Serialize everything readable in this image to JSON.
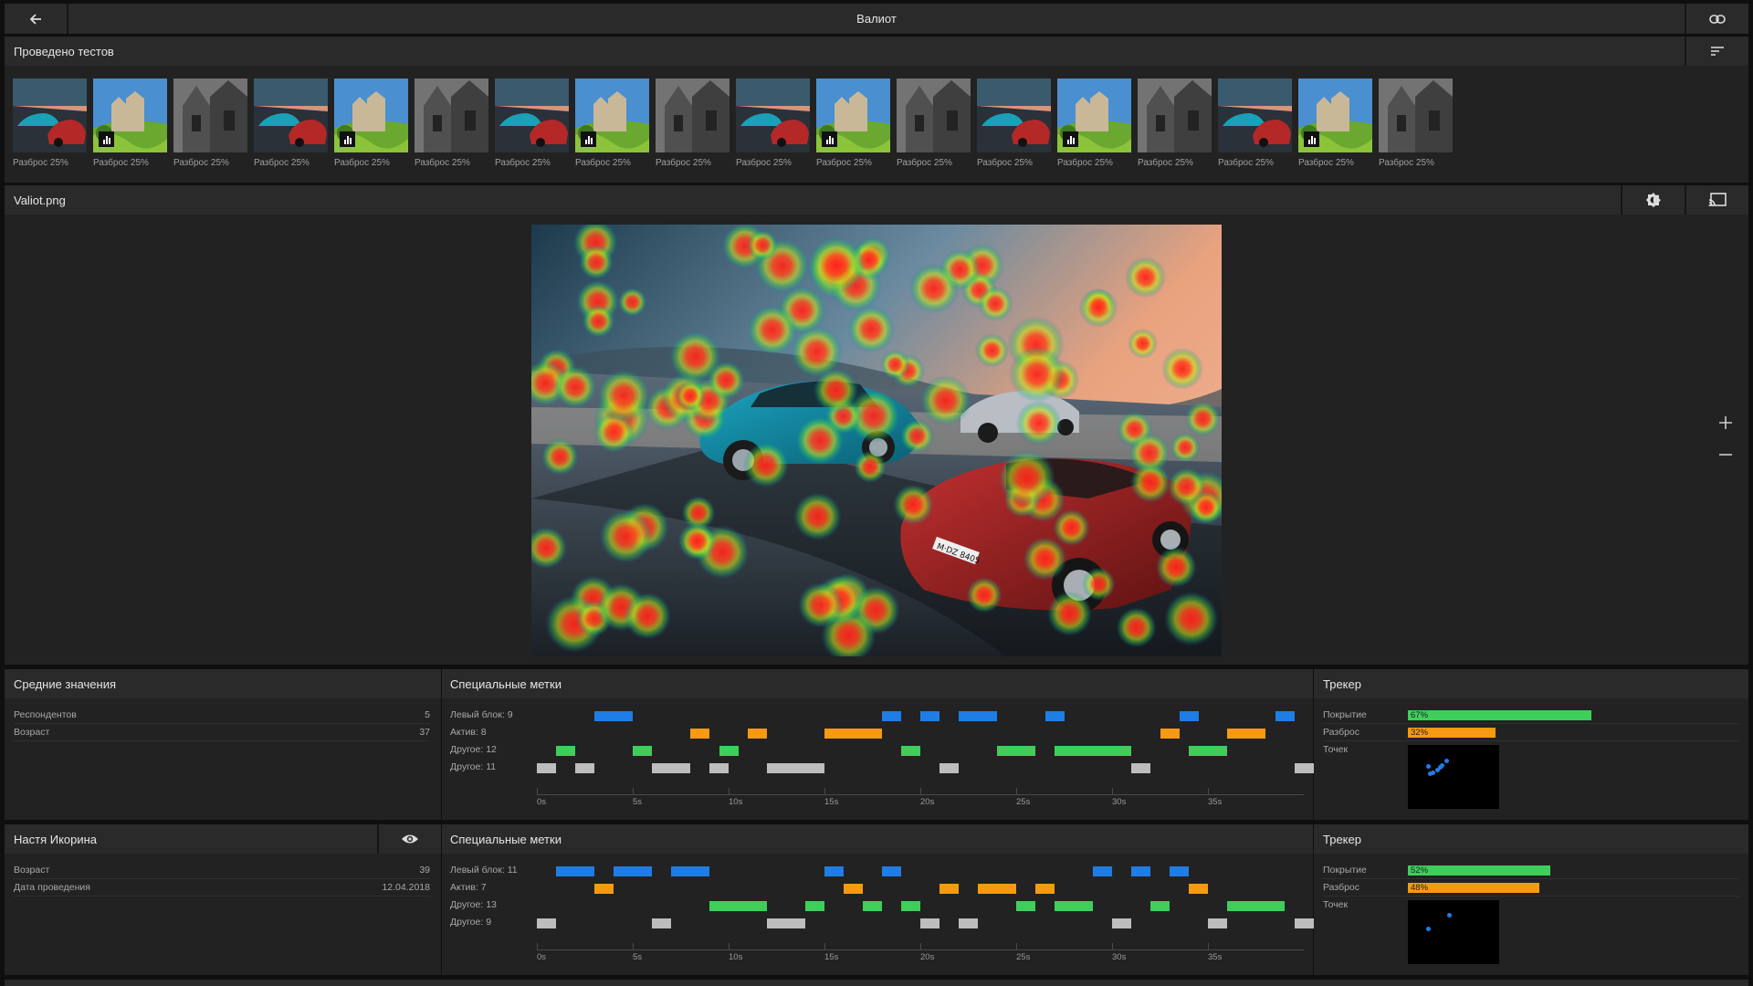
{
  "topbar": {
    "title": "Валиот"
  },
  "tests": {
    "title": "Проведено тестов",
    "thumbs": [
      {
        "kind": "cars",
        "caption": "Разброс 25%"
      },
      {
        "kind": "castle",
        "caption": "Разброс 25%",
        "badge": true
      },
      {
        "kind": "church",
        "caption": "Разброс 25%"
      },
      {
        "kind": "cars",
        "caption": "Разброс 25%"
      },
      {
        "kind": "castle",
        "caption": "Разброс 25%",
        "badge": true
      },
      {
        "kind": "church",
        "caption": "Разброс 25%"
      },
      {
        "kind": "cars",
        "caption": "Разброс 25%"
      },
      {
        "kind": "castle",
        "caption": "Разброс 25%",
        "badge": true
      },
      {
        "kind": "church",
        "caption": "Разброс 25%"
      },
      {
        "kind": "cars",
        "caption": "Разброс 25%"
      },
      {
        "kind": "castle",
        "caption": "Разброс 25%",
        "badge": true
      },
      {
        "kind": "church",
        "caption": "Разброс 25%"
      },
      {
        "kind": "cars",
        "caption": "Разброс 25%"
      },
      {
        "kind": "castle",
        "caption": "Разброс 25%",
        "badge": true
      },
      {
        "kind": "church",
        "caption": "Разброс 25%"
      },
      {
        "kind": "cars",
        "caption": "Разброс 25%"
      },
      {
        "kind": "castle",
        "caption": "Разброс 25%",
        "badge": true
      },
      {
        "kind": "church",
        "caption": "Разброс 25%"
      }
    ]
  },
  "viewer": {
    "filename": "Valiot.png",
    "plate": "M·DZ 8405"
  },
  "colors": {
    "blue": "#1f7de6",
    "orange": "#f59a12",
    "green": "#3ecf5a",
    "gray": "#bdbdbd"
  },
  "averages": {
    "title": "Средние значения",
    "rows": [
      {
        "label": "Респондентов",
        "value": "5"
      },
      {
        "label": "Возраст",
        "value": "37"
      }
    ]
  },
  "person": {
    "name": "Настя Икорина",
    "rows": [
      {
        "label": "Возраст",
        "value": "39"
      },
      {
        "label": "Дата проведения",
        "value": "12.04.2018"
      }
    ]
  },
  "marks": [
    {
      "title": "Специальные метки",
      "ticks": [
        "0s",
        "5s",
        "10s",
        "15s",
        "20s",
        "25s",
        "30s",
        "35s"
      ],
      "rows": [
        {
          "label": "Левый блок: 9",
          "color": "blue",
          "segments": [
            [
              3,
              5
            ],
            [
              18,
              19
            ],
            [
              20,
              21
            ],
            [
              22,
              24
            ],
            [
              26.5,
              27.5
            ],
            [
              33.5,
              34.5
            ],
            [
              38.5,
              39.5
            ]
          ]
        },
        {
          "label": "Актив: 8",
          "color": "orange",
          "segments": [
            [
              8,
              9
            ],
            [
              11,
              12
            ],
            [
              15,
              18
            ],
            [
              32.5,
              33.5
            ],
            [
              36,
              38
            ]
          ]
        },
        {
          "label": "Другое: 12",
          "color": "green",
          "segments": [
            [
              1,
              2
            ],
            [
              5,
              6
            ],
            [
              9.5,
              10.5
            ],
            [
              19,
              20
            ],
            [
              24,
              26
            ],
            [
              27,
              31
            ],
            [
              34,
              36
            ]
          ]
        },
        {
          "label": "Другое: 11",
          "color": "gray",
          "segments": [
            [
              0,
              1
            ],
            [
              2,
              3
            ],
            [
              6,
              8
            ],
            [
              9,
              10
            ],
            [
              12,
              15
            ],
            [
              21,
              22
            ],
            [
              31,
              32
            ],
            [
              39.5,
              40.5
            ]
          ]
        }
      ]
    },
    {
      "title": "Специальные метки",
      "ticks": [
        "0s",
        "5s",
        "10s",
        "15s",
        "20s",
        "25s",
        "30s",
        "35s"
      ],
      "rows": [
        {
          "label": "Левый блок: 11",
          "color": "blue",
          "segments": [
            [
              1,
              3
            ],
            [
              4,
              6
            ],
            [
              7,
              9
            ],
            [
              15,
              16
            ],
            [
              18,
              19
            ],
            [
              29,
              30
            ],
            [
              31,
              32
            ],
            [
              33,
              34
            ]
          ]
        },
        {
          "label": "Актив: 7",
          "color": "orange",
          "segments": [
            [
              3,
              4
            ],
            [
              16,
              17
            ],
            [
              21,
              22
            ],
            [
              23,
              25
            ],
            [
              26,
              27
            ],
            [
              34,
              35
            ]
          ]
        },
        {
          "label": "Другое: 13",
          "color": "green",
          "segments": [
            [
              9,
              12
            ],
            [
              14,
              15
            ],
            [
              17,
              18
            ],
            [
              19,
              20
            ],
            [
              25,
              26
            ],
            [
              27,
              29
            ],
            [
              32,
              33
            ],
            [
              36,
              39
            ]
          ]
        },
        {
          "label": "Другое: 9",
          "color": "gray",
          "segments": [
            [
              0,
              1
            ],
            [
              6,
              7
            ],
            [
              12,
              14
            ],
            [
              20,
              21
            ],
            [
              22,
              23
            ],
            [
              30,
              31
            ],
            [
              35,
              36
            ],
            [
              39.5,
              40.5
            ]
          ]
        }
      ]
    }
  ],
  "trackers": [
    {
      "title": "Трекер",
      "coverage": {
        "label": "Покрытие",
        "value": 67,
        "text": "67%"
      },
      "spread": {
        "label": "Разброс",
        "value": 32,
        "text": "32%"
      },
      "points": {
        "label": "Точек",
        "dots": [
          [
            0.2,
            0.3
          ],
          [
            0.25,
            0.4
          ],
          [
            0.3,
            0.35
          ],
          [
            0.35,
            0.28
          ],
          [
            0.4,
            0.22
          ],
          [
            0.33,
            0.32
          ],
          [
            0.22,
            0.42
          ]
        ]
      }
    },
    {
      "title": "Трекер",
      "coverage": {
        "label": "Покрытие",
        "value": 52,
        "text": "52%"
      },
      "spread": {
        "label": "Разброс",
        "value": 48,
        "text": "48%"
      },
      "points": {
        "label": "Точек",
        "dots": [
          [
            0.2,
            0.42
          ],
          [
            0.43,
            0.2
          ]
        ]
      }
    }
  ]
}
